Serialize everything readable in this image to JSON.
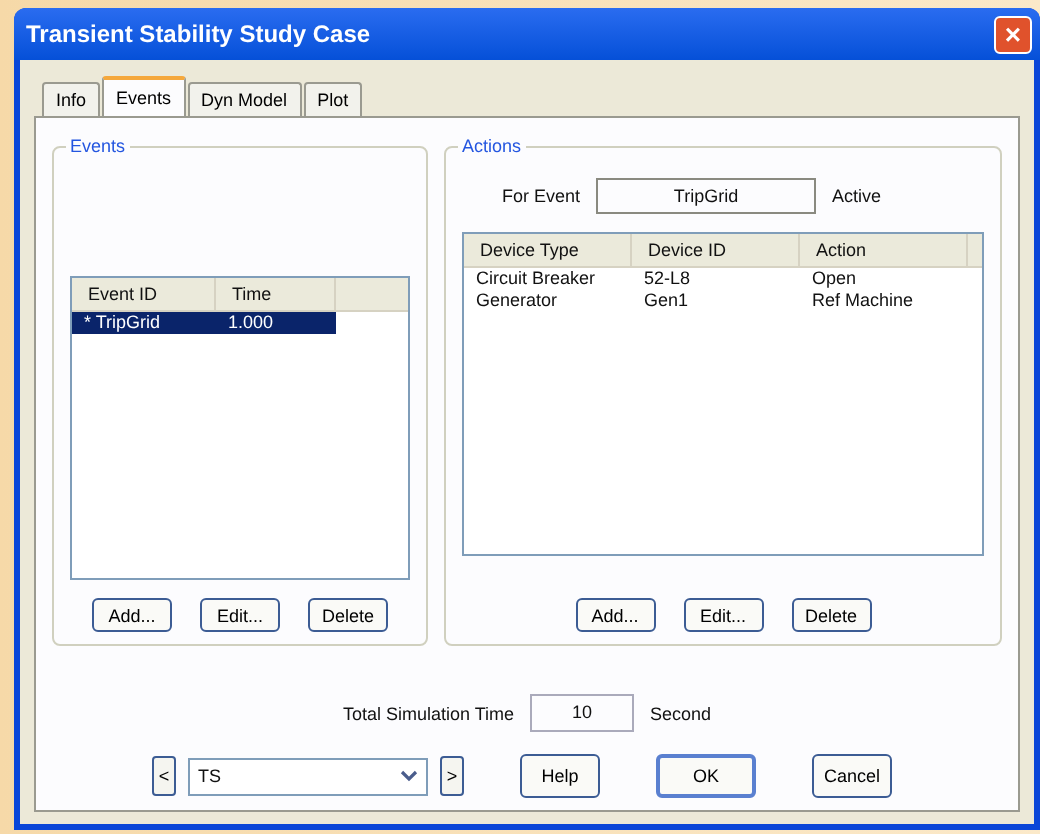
{
  "window": {
    "title": "Transient Stability Study Case",
    "close": "×"
  },
  "tabs": [
    {
      "label": "Info",
      "selected": false
    },
    {
      "label": "Events",
      "selected": true
    },
    {
      "label": "Dyn Model",
      "selected": false
    },
    {
      "label": "Plot",
      "selected": false
    }
  ],
  "events": {
    "title": "Events",
    "columns": [
      "Event ID",
      "Time"
    ],
    "rows": [
      {
        "cells": [
          "* TripGrid",
          "1.000"
        ],
        "selected": true
      }
    ],
    "buttons": [
      "Add...",
      "Edit...",
      "Delete"
    ]
  },
  "actions": {
    "title": "Actions",
    "for_event_label": "For Event",
    "for_event_value": "TripGrid",
    "status": "Active",
    "columns": [
      "Device Type",
      "Device ID",
      "Action"
    ],
    "rows": [
      {
        "cells": [
          "Circuit Breaker",
          "52-L8",
          "Open"
        ],
        "selected": false
      },
      {
        "cells": [
          "Generator",
          "Gen1",
          "Ref Machine"
        ],
        "selected": false
      }
    ],
    "buttons": [
      "Add...",
      "Edit...",
      "Delete"
    ]
  },
  "simulation": {
    "label": "Total Simulation Time",
    "value": "10",
    "unit": "Second"
  },
  "footer": {
    "prev": "<",
    "study_case": "TS",
    "next": ">",
    "buttons": [
      "Help",
      "OK",
      "Cancel"
    ]
  }
}
